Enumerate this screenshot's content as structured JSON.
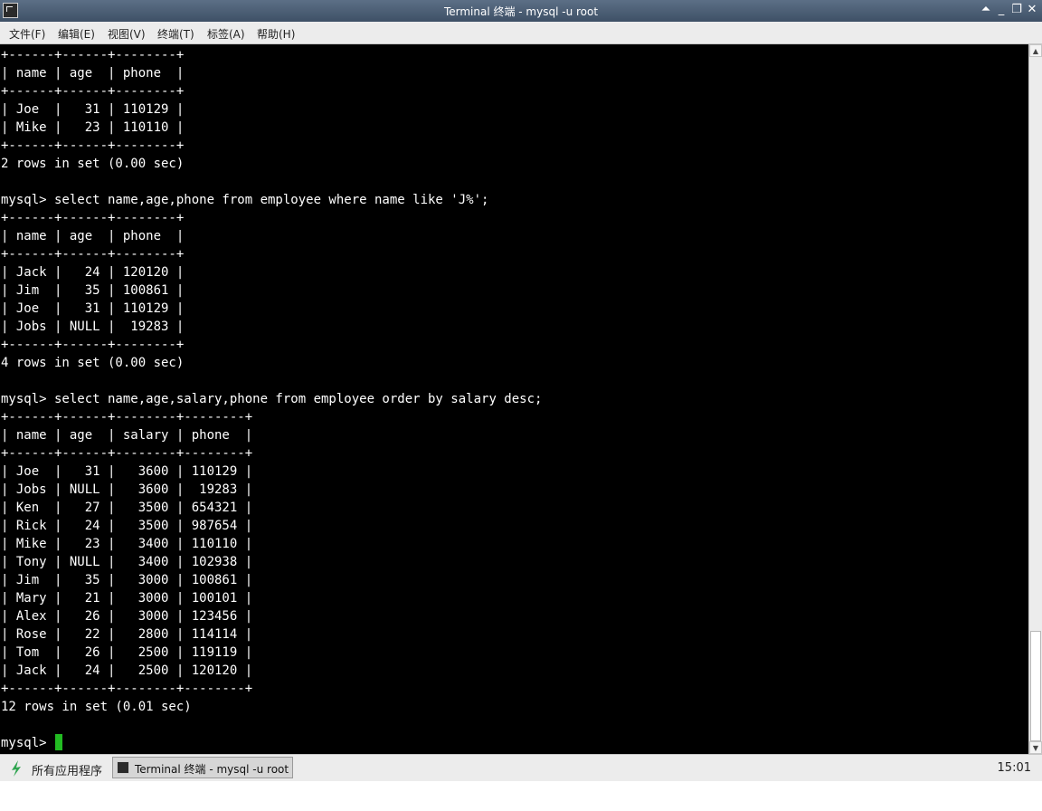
{
  "window": {
    "title": "Terminal 终端 - mysql -u root",
    "controls": {
      "shade": "⏶",
      "minimize": "_",
      "maximize": "❐",
      "close": "✕"
    }
  },
  "menu": [
    "文件(F)",
    "编辑(E)",
    "视图(V)",
    "终端(T)",
    "标签(A)",
    "帮助(H)"
  ],
  "terminal": {
    "lines": [
      "+------+------+--------+",
      "| name | age  | phone  |",
      "+------+------+--------+",
      "| Joe  |   31 | 110129 |",
      "| Mike |   23 | 110110 |",
      "+------+------+--------+",
      "2 rows in set (0.00 sec)",
      "",
      "mysql> select name,age,phone from employee where name like 'J%';",
      "+------+------+--------+",
      "| name | age  | phone  |",
      "+------+------+--------+",
      "| Jack |   24 | 120120 |",
      "| Jim  |   35 | 100861 |",
      "| Joe  |   31 | 110129 |",
      "| Jobs | NULL |  19283 |",
      "+------+------+--------+",
      "4 rows in set (0.00 sec)",
      "",
      "mysql> select name,age,salary,phone from employee order by salary desc;",
      "+------+------+--------+--------+",
      "| name | age  | salary | phone  |",
      "+------+------+--------+--------+",
      "| Joe  |   31 |   3600 | 110129 |",
      "| Jobs | NULL |   3600 |  19283 |",
      "| Ken  |   27 |   3500 | 654321 |",
      "| Rick |   24 |   3500 | 987654 |",
      "| Mike |   23 |   3400 | 110110 |",
      "| Tony | NULL |   3400 | 102938 |",
      "| Jim  |   35 |   3000 | 100861 |",
      "| Mary |   21 |   3000 | 100101 |",
      "| Alex |   26 |   3000 | 123456 |",
      "| Rose |   22 |   2800 | 114114 |",
      "| Tom  |   26 |   2500 | 119119 |",
      "| Jack |   24 |   2500 | 120120 |",
      "+------+------+--------+--------+",
      "12 rows in set (0.01 sec)",
      ""
    ],
    "prompt": "mysql> ",
    "cursor_color": "#22bb22",
    "background": "#000000",
    "foreground": "#ffffff"
  },
  "taskbar": {
    "start_label": "所有应用程序",
    "task_label": "Terminal 终端 - mysql -u root",
    "clock": "15:01"
  },
  "icons": {
    "window": "terminal-icon",
    "start": "leaf-icon",
    "task": "terminal-icon"
  }
}
